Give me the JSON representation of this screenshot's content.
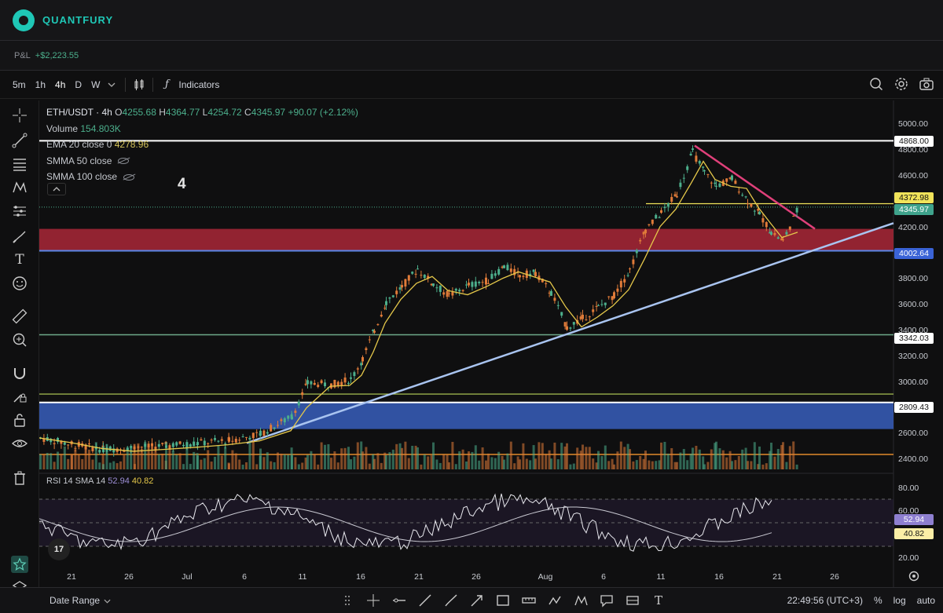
{
  "app": {
    "brand": "QUANTFURY"
  },
  "pnl": {
    "label": "P&L",
    "value": "+$2,223.55"
  },
  "toolbar": {
    "timeframes": [
      "5m",
      "1h",
      "4h",
      "D",
      "W"
    ],
    "indicators_label": "Indicators",
    "icons": [
      "chevron-down-icon",
      "candles-icon",
      "fx-icon",
      "search-icon",
      "gear-icon",
      "camera-icon"
    ]
  },
  "legend": {
    "symbol": "ETH/USDT · 4h",
    "o_label": "O",
    "o": "4255.68",
    "h_label": "H",
    "h": "4364.77",
    "l_label": "L",
    "l": "4254.72",
    "c_label": "C",
    "c": "4345.97",
    "change": "+90.07 (+2.12%)",
    "volume_label": "Volume",
    "volume": "154.803K",
    "ema_label": "EMA 20 close 0",
    "ema": "4278.96",
    "smma50_label": "SMMA 50 close",
    "smma100_label": "SMMA 100 close",
    "annotation": "4"
  },
  "price_axis": {
    "ticks": [
      "5000.00",
      "4800.00",
      "4600.00",
      "4200.00",
      "3800.00",
      "3600.00",
      "3400.00",
      "3200.00",
      "3000.00",
      "2600.00",
      "2400.00"
    ],
    "tags": [
      {
        "text": "4868.00",
        "bg": "#ffffff",
        "fg": "#111111"
      },
      {
        "text": "4372.98",
        "bg": "#f0e35a",
        "fg": "#111111"
      },
      {
        "text": "4345.97",
        "bg": "#3fa38c",
        "fg": "#ffffff"
      },
      {
        "text": "4002.64",
        "bg": "#3a63d6",
        "fg": "#ffffff"
      },
      {
        "text": "3342.03",
        "bg": "#ffffff",
        "fg": "#111111"
      },
      {
        "text": "2809.43",
        "bg": "#ffffff",
        "fg": "#111111"
      }
    ]
  },
  "rsi": {
    "label": "RSI 14 SMA 14",
    "rsi_value": "52.94",
    "sma_value": "40.82",
    "ticks": [
      "80.00",
      "60.00",
      "40.00",
      "20.00"
    ],
    "tv_badge": "17"
  },
  "date_axis": [
    "21",
    "26",
    "Jul",
    "6",
    "11",
    "16",
    "21",
    "26",
    "Aug",
    "6",
    "11",
    "16",
    "21",
    "26"
  ],
  "bottom": {
    "date_range_label": "Date Range",
    "time": "22:49:56 (UTC+3)",
    "percent": "%",
    "log": "log",
    "auto": "auto"
  },
  "colors": {
    "bg": "#0f0f10",
    "up": "#4caf8c",
    "down": "#e07b39",
    "ema": "#e5c84a",
    "red_zone": "#b3283a",
    "blue_zone": "#3a63c7",
    "trend": "#a9c4f0",
    "downtrend": "#e0407a"
  }
}
